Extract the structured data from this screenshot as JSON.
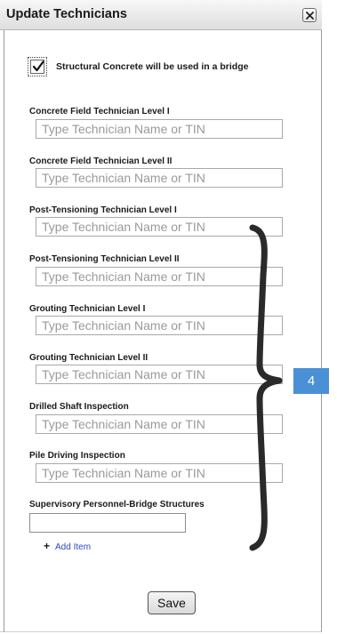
{
  "dialog": {
    "title": "Update Technicians",
    "close_icon": "close-icon"
  },
  "structural_checkbox": {
    "checked": true,
    "label": "Structural Concrete will be used in a bridge"
  },
  "fields": [
    {
      "label": "Concrete Field Technician Level I",
      "placeholder": "Type Technician Name or TIN",
      "value": ""
    },
    {
      "label": "Concrete Field Technician Level II",
      "placeholder": "Type Technician Name or TIN",
      "value": ""
    },
    {
      "label": "Post-Tensioning Technician Level I",
      "placeholder": "Type Technician Name or TIN",
      "value": ""
    },
    {
      "label": "Post-Tensioning Technician Level II",
      "placeholder": "Type Technician Name or TIN",
      "value": ""
    },
    {
      "label": "Grouting Technician Level I",
      "placeholder": "Type Technician Name or TIN",
      "value": ""
    },
    {
      "label": "Grouting Technician Level II",
      "placeholder": "Type Technician Name or TIN",
      "value": ""
    },
    {
      "label": "Drilled Shaft Inspection",
      "placeholder": "Type Technician Name or TIN",
      "value": ""
    },
    {
      "label": "Pile Driving Inspection",
      "placeholder": "Type Technician Name or TIN",
      "value": ""
    }
  ],
  "supervisory": {
    "label": "Supervisory Personnel-Bridge Structures",
    "value": "",
    "add_item_label": "Add Item"
  },
  "save_label": "Save",
  "annotation": {
    "badge_text": "4",
    "badge_color": "#4a90d6",
    "brace_color": "#2a2a2a"
  }
}
